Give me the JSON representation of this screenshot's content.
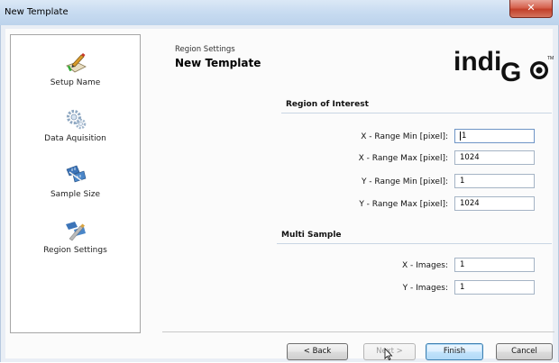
{
  "window": {
    "title": "New Template",
    "close_glyph": "✕"
  },
  "steps": [
    {
      "label": "Setup Name",
      "icon": "pen-paper-icon"
    },
    {
      "label": "Data Aquisition",
      "icon": "gears-icon"
    },
    {
      "label": "Sample Size",
      "icon": "measure-icon"
    },
    {
      "label": "Region Settings",
      "icon": "region-icon",
      "active": true
    }
  ],
  "header": {
    "subtitle": "Region Settings",
    "title": "New Template",
    "logo_text": "indiGO",
    "logo_mark": "TM"
  },
  "roi": {
    "title": "Region of Interest",
    "fields": [
      {
        "label": "X - Range Min [pixel]:",
        "value": "1"
      },
      {
        "label": "X - Range Max [pixel]:",
        "value": "1024"
      },
      {
        "label": "Y - Range Min [pixel]:",
        "value": "1"
      },
      {
        "label": "Y - Range Max [pixel]:",
        "value": "1024"
      }
    ]
  },
  "multi": {
    "title": "Multi Sample",
    "fields": [
      {
        "label": "X - Images:",
        "value": "1"
      },
      {
        "label": "Y - Images:",
        "value": "1"
      }
    ]
  },
  "buttons": {
    "back": "< Back",
    "next": "Next >",
    "finish": "Finish",
    "cancel": "Cancel"
  },
  "colors": {
    "accent": "#3c7fb1",
    "titlebar": "#c6daf0",
    "close": "#c2402a"
  }
}
